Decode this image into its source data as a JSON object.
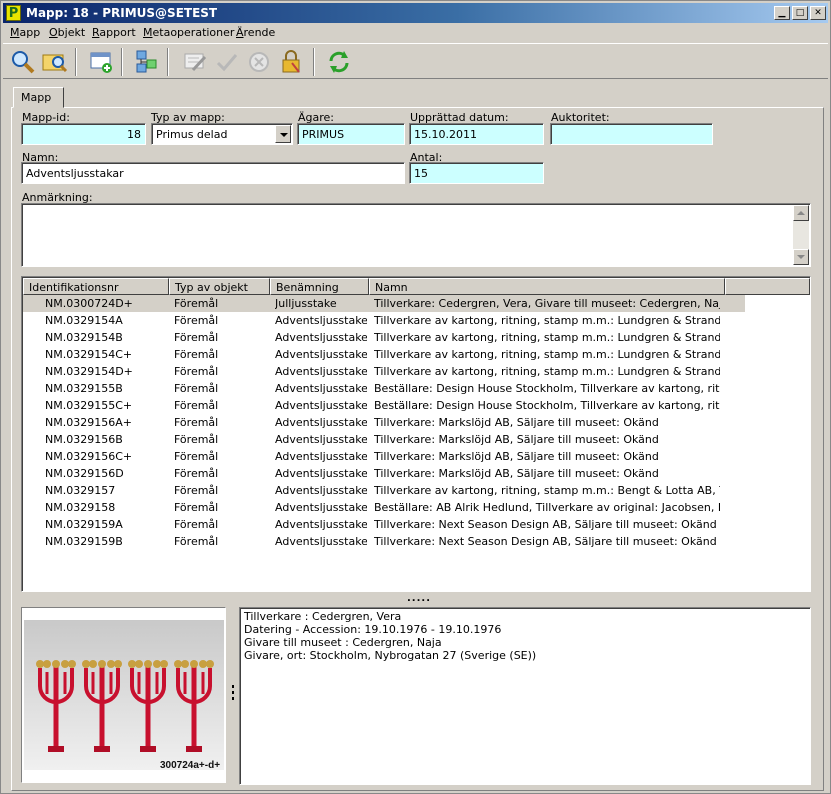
{
  "window": {
    "title": "Mapp: 18 - PRIMUS@SETEST",
    "app_icon_letter": "P"
  },
  "menu": [
    "Mapp",
    "Objekt",
    "Rapport",
    "Metaoperationer",
    "Ärende"
  ],
  "toolbar": {
    "buttons": [
      "search-icon",
      "search-folder-icon",
      "new-record-icon",
      "tree-icon",
      "edit-icon",
      "checkmark-icon",
      "cancel-icon",
      "lock-icon",
      "refresh-icon"
    ]
  },
  "tabs": [
    "Mapp"
  ],
  "form": {
    "mapp_id": {
      "label": "Mapp-id:",
      "value": "18"
    },
    "typ": {
      "label": "Typ av mapp:",
      "value": "Primus delad"
    },
    "agare": {
      "label": "Ägare:",
      "value": "PRIMUS"
    },
    "upprattad": {
      "label": "Upprättad datum:",
      "value": "15.10.2011"
    },
    "auktoritet": {
      "label": "Auktoritet:",
      "value": ""
    },
    "namn": {
      "label": "Namn:",
      "value": "Adventsljusstakar"
    },
    "antal": {
      "label": "Antal:",
      "value": "15"
    },
    "anmarkning": {
      "label": "Anmärkning:",
      "value": ""
    }
  },
  "grid": {
    "columns": [
      "Identifikationsnr",
      "Typ av objekt",
      "Benämning",
      "Namn"
    ],
    "rows": [
      [
        "NM.0300724D+",
        "Föremål",
        "Julljusstake",
        "Tillverkare: Cedergren, Vera, Givare till museet: Cedergren, Naja"
      ],
      [
        "NM.0329154A",
        "Föremål",
        "Adventsljusstake",
        "Tillverkare av kartong, ritning, stamp m.m.: Lundgren & Strandbe..."
      ],
      [
        "NM.0329154B",
        "Föremål",
        "Adventsljusstake",
        "Tillverkare av kartong, ritning, stamp m.m.: Lundgren & Strandbe..."
      ],
      [
        "NM.0329154C+",
        "Föremål",
        "Adventsljusstake",
        "Tillverkare av kartong, ritning, stamp m.m.: Lundgren & Strandbe..."
      ],
      [
        "NM.0329154D+",
        "Föremål",
        "Adventsljusstake",
        "Tillverkare av kartong, ritning, stamp m.m.: Lundgren & Strandbe..."
      ],
      [
        "NM.0329155B",
        "Föremål",
        "Adventsljusstake",
        "Beställare: Design House Stockholm, Tillverkare av kartong, ritnin..."
      ],
      [
        "NM.0329155C+",
        "Föremål",
        "Adventsljusstake",
        "Beställare: Design House Stockholm, Tillverkare av kartong, ritnin..."
      ],
      [
        "NM.0329156A+",
        "Föremål",
        "Adventsljusstake",
        "Tillverkare: Markslöjd AB, Säljare till museet: Okänd"
      ],
      [
        "NM.0329156B",
        "Föremål",
        "Adventsljusstake",
        "Tillverkare: Markslöjd AB, Säljare till museet: Okänd"
      ],
      [
        "NM.0329156C+",
        "Föremål",
        "Adventsljusstake",
        "Tillverkare: Markslöjd AB, Säljare till museet: Okänd"
      ],
      [
        "NM.0329156D",
        "Föremål",
        "Adventsljusstake",
        "Tillverkare: Markslöjd AB, Säljare till museet: Okänd"
      ],
      [
        "NM.0329157",
        "Föremål",
        "Adventsljusstake",
        "Tillverkare av kartong, ritning, stamp m.m.: Bengt & Lotta AB, Tillv..."
      ],
      [
        "NM.0329158",
        "Föremål",
        "Adventsljusstake",
        "Beställare: AB Alrik Hedlund, Tillverkare av original: Jacobsen, Lar..."
      ],
      [
        "NM.0329159A",
        "Föremål",
        "Adventsljusstake",
        "Tillverkare: Next Season Design AB, Säljare till museet: Okänd"
      ],
      [
        "NM.0329159B",
        "Föremål",
        "Adventsljusstake",
        "Tillverkare: Next Season Design AB, Säljare till museet: Okänd"
      ]
    ],
    "selected_row": 0
  },
  "splitter_label": ".....",
  "image": {
    "caption": "300724a+-d+"
  },
  "details": [
    "Tillverkare : Cedergren, Vera",
    "Datering - Accession: 19.10.1976 - 19.10.1976",
    "Givare till museet : Cedergren, Naja",
    "Givare, ort: Stockholm, Nybrogatan 27 (Sverige (SE))"
  ]
}
